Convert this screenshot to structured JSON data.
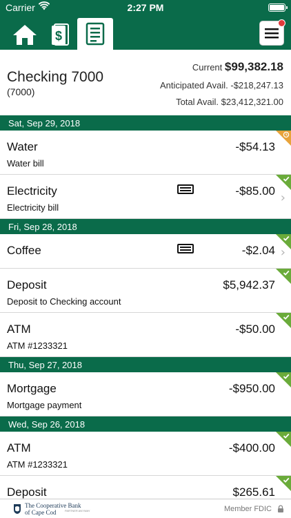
{
  "status": {
    "carrier": "Carrier",
    "time": "2:27 PM"
  },
  "nav": {
    "tabs": [
      "home-icon",
      "money-icon",
      "ledger-icon"
    ],
    "active_tab": "ledger-icon",
    "menu_icon": "hamburger-icon",
    "notification_color": "#e03a3a"
  },
  "account": {
    "name": "Checking 7000",
    "number": "(7000)",
    "current_label": "Current",
    "current_value": "$99,382.18",
    "anticipated_label": "Anticipated Avail.",
    "anticipated_value": "-$218,247.13",
    "total_label": "Total Avail.",
    "total_value": "$23,412,321.00"
  },
  "groups": [
    {
      "date": "Sat, Sep 29, 2018",
      "transactions": [
        {
          "title": "Water",
          "desc": "Water bill",
          "amount": "-$54.13",
          "status": "pending",
          "card": false,
          "chevron": false
        },
        {
          "title": "Electricity",
          "desc": "Electricity bill",
          "amount": "-$85.00",
          "status": "cleared",
          "card": true,
          "chevron": true
        }
      ]
    },
    {
      "date": "Fri, Sep 28, 2018",
      "transactions": [
        {
          "title": "Coffee",
          "desc": "",
          "amount": "-$2.04",
          "status": "cleared",
          "card": true,
          "chevron": true
        },
        {
          "title": "Deposit",
          "desc": "Deposit to Checking account",
          "amount": "$5,942.37",
          "status": "cleared",
          "card": false,
          "chevron": false
        },
        {
          "title": "ATM",
          "desc": "ATM #1233321",
          "amount": "-$50.00",
          "status": "cleared",
          "card": false,
          "chevron": false
        }
      ]
    },
    {
      "date": "Thu, Sep 27, 2018",
      "transactions": [
        {
          "title": "Mortgage",
          "desc": "Mortgage payment",
          "amount": "-$950.00",
          "status": "cleared",
          "card": false,
          "chevron": false
        }
      ]
    },
    {
      "date": "Wed, Sep 26, 2018",
      "transactions": [
        {
          "title": "ATM",
          "desc": "ATM #1233321",
          "amount": "-$400.00",
          "status": "cleared",
          "card": false,
          "chevron": false
        },
        {
          "title": "Deposit",
          "desc": "",
          "amount": "$265.61",
          "status": "cleared",
          "card": false,
          "chevron": false
        }
      ]
    }
  ],
  "footer": {
    "bank_line1": "The Cooperative Bank",
    "bank_line2": "of Cape Cod",
    "tagline": "PARTNER ANYWAY",
    "fdic": "Member FDIC"
  },
  "colors": {
    "brand": "#0a6b4a",
    "cleared": "#6aab3a",
    "pending": "#e8a33a"
  }
}
